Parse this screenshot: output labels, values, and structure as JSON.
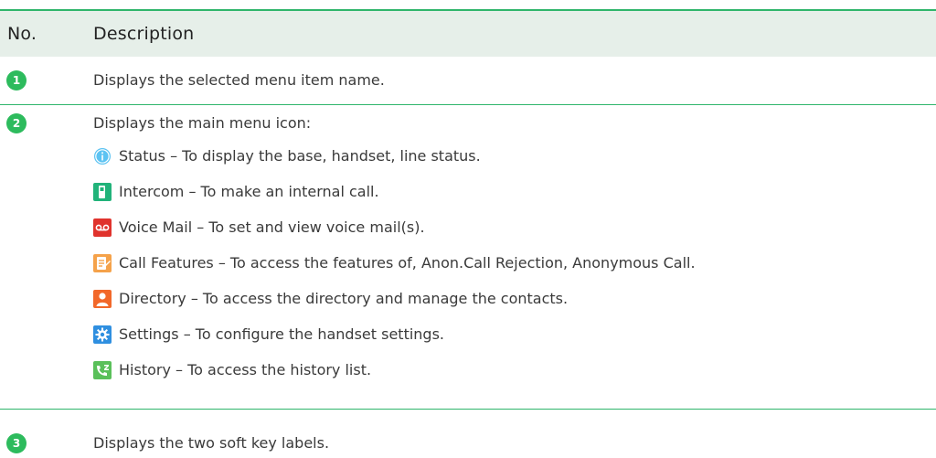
{
  "table": {
    "headers": {
      "no": "No.",
      "description": "Description"
    },
    "rows": [
      {
        "number": "1",
        "description": "Displays the selected menu item name."
      },
      {
        "number": "2",
        "description": "Displays the main menu icon:",
        "icons": [
          {
            "icon": "status-icon",
            "text": "Status – To display the base, handset, line status."
          },
          {
            "icon": "intercom-icon",
            "text": "Intercom – To make an internal call."
          },
          {
            "icon": "voice-mail-icon",
            "text": "Voice Mail – To set and view voice mail(s)."
          },
          {
            "icon": "call-features-icon",
            "text": "Call Features – To access the features of, Anon.Call Rejection, Anonymous Call."
          },
          {
            "icon": "directory-icon",
            "text": "Directory – To access the directory and manage the contacts."
          },
          {
            "icon": "settings-icon",
            "text": "Settings – To configure the handset settings."
          },
          {
            "icon": "history-icon",
            "text": "History – To access the history list."
          }
        ]
      },
      {
        "number": "3",
        "description": "Displays the two soft key labels."
      }
    ]
  },
  "colors": {
    "accent_green": "#2fb56b",
    "header_bg": "#e6efe9",
    "badge_green": "#2dbb5d"
  }
}
